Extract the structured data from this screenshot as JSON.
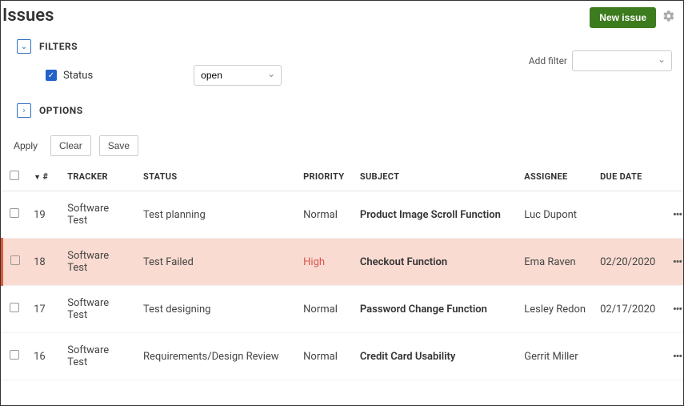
{
  "page": {
    "title": "Issues"
  },
  "header": {
    "newIssue": "New issue"
  },
  "filters": {
    "title": "FILTERS",
    "statusLabel": "Status",
    "statusValue": "open",
    "addFilterLabel": "Add filter",
    "addFilterValue": ""
  },
  "options": {
    "title": "OPTIONS"
  },
  "actions": {
    "apply": "Apply",
    "clear": "Clear",
    "save": "Save"
  },
  "columns": {
    "id": "#",
    "tracker": "TRACKER",
    "status": "STATUS",
    "priority": "PRIORITY",
    "subject": "SUBJECT",
    "assignee": "ASSIGNEE",
    "dueDate": "DUE DATE"
  },
  "rows": [
    {
      "id": "19",
      "tracker": "Software Test",
      "status": "Test planning",
      "priority": "Normal",
      "priorityClass": "",
      "subject": "Product Image Scroll Function",
      "assignee": "Luc Dupont",
      "dueDate": "",
      "highlight": false
    },
    {
      "id": "18",
      "tracker": "Software Test",
      "status": "Test Failed",
      "priority": "High",
      "priorityClass": "priority-high",
      "subject": "Checkout Function",
      "assignee": "Ema Raven",
      "dueDate": "02/20/2020",
      "highlight": true
    },
    {
      "id": "17",
      "tracker": "Software Test",
      "status": "Test designing",
      "priority": "Normal",
      "priorityClass": "",
      "subject": "Password Change Function",
      "assignee": "Lesley Redon",
      "dueDate": "02/17/2020",
      "highlight": false
    },
    {
      "id": "16",
      "tracker": "Software Test",
      "status": "Requirements/Design Review",
      "priority": "Normal",
      "priorityClass": "",
      "subject": "Credit Card Usability",
      "assignee": "Gerrit Miller",
      "dueDate": "",
      "highlight": false
    }
  ]
}
